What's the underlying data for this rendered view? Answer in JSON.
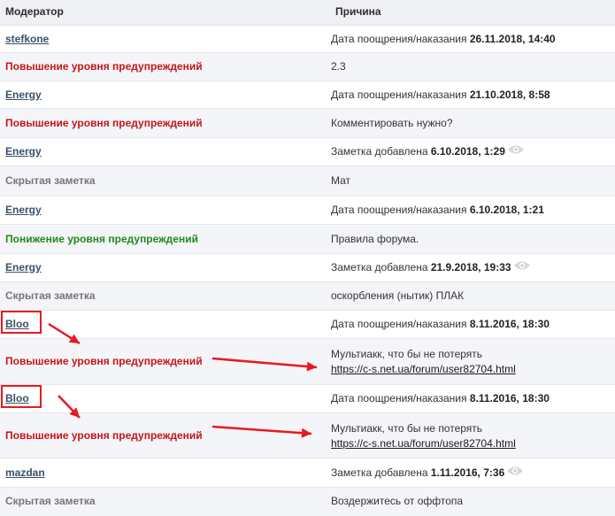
{
  "header": {
    "moderator": "Модератор",
    "reason": "Причина"
  },
  "rows": [
    {
      "left": "stefkone",
      "left_type": "user",
      "right_prefix": "Дата поощрения/наказания ",
      "right_bold": "26.11.2018, 14:40",
      "eye": false
    },
    {
      "left": "Повышение уровня предупреждений",
      "left_type": "warn-up",
      "right_text": "2.3"
    },
    {
      "left": "Energy",
      "left_type": "user",
      "right_prefix": "Дата поощрения/наказания ",
      "right_bold": "21.10.2018, 8:58",
      "eye": false
    },
    {
      "left": "Повышение уровня предупреждений",
      "left_type": "warn-up",
      "right_text": "Комментировать нужно?"
    },
    {
      "left": "Energy",
      "left_type": "user",
      "right_prefix": "Заметка добавлена ",
      "right_bold": "6.10.2018, 1:29",
      "eye": true
    },
    {
      "left": "Скрытая заметка",
      "left_type": "hidden",
      "right_text": "Мат"
    },
    {
      "left": "Energy",
      "left_type": "user",
      "right_prefix": "Дата поощрения/наказания ",
      "right_bold": "6.10.2018, 1:21",
      "eye": false
    },
    {
      "left": "Понижение уровня предупреждений",
      "left_type": "warn-down",
      "right_text": "Правила форума."
    },
    {
      "left": "Energy",
      "left_type": "user",
      "right_prefix": "Заметка добавлена ",
      "right_bold": "21.9.2018, 19:33",
      "eye": true
    },
    {
      "left": "Скрытая заметка",
      "left_type": "hidden",
      "right_text": "оскорбления (нытик) ПЛАК"
    },
    {
      "left": "Bloo",
      "left_type": "user",
      "right_prefix": "Дата поощрения/наказания ",
      "right_bold": "8.11.2016, 18:30",
      "eye": false
    },
    {
      "left": "Повышение уровня предупреждений",
      "left_type": "warn-up",
      "right_text": "Мультиакк, что бы не потерять",
      "right_link": "https://c-s.net.ua/forum/user82704.html"
    },
    {
      "left": "Bloo",
      "left_type": "user",
      "right_prefix": "Дата поощрения/наказания ",
      "right_bold": "8.11.2016, 18:30",
      "eye": false
    },
    {
      "left": "Повышение уровня предупреждений",
      "left_type": "warn-up",
      "right_text": "Мультиакк, что бы не потерять",
      "right_link": "https://c-s.net.ua/forum/user82704.html"
    },
    {
      "left": "mazdan",
      "left_type": "user",
      "right_prefix": "Заметка добавлена ",
      "right_bold": "1.11.2016, 7:36",
      "eye": true
    },
    {
      "left": "Скрытая заметка",
      "left_type": "hidden",
      "right_text": "Воздержитесь от оффтопа"
    }
  ],
  "colors": {
    "warn_up": "#c5161a",
    "warn_down": "#23881e",
    "user_link": "#3a5068",
    "hidden": "#767676",
    "annotation": "#e8191f"
  },
  "icons": {
    "eye": "eye-icon",
    "annotation_arrow": "red-arrow"
  }
}
